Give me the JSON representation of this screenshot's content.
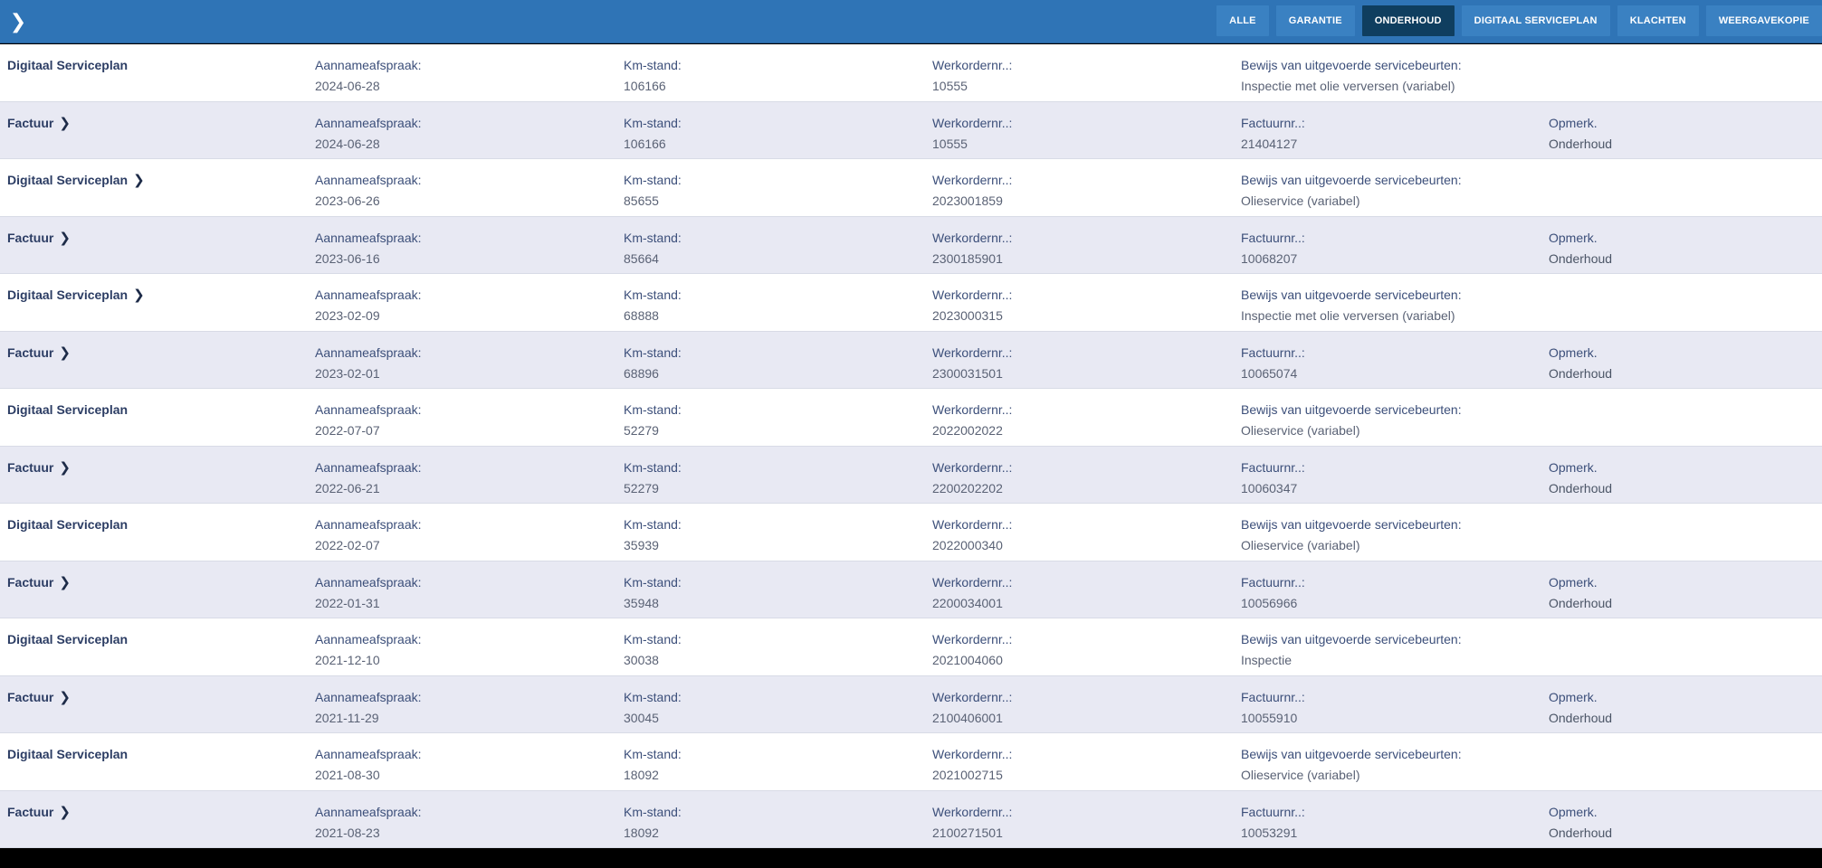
{
  "topbar": {
    "toggle_icon": "chevron-right-icon",
    "toggle_glyph": "❯",
    "tabs": [
      {
        "label": "ALLE"
      },
      {
        "label": "GARANTIE"
      },
      {
        "label": "ONDERHOUD"
      },
      {
        "label": "DIGITAAL SERVICEPLAN"
      },
      {
        "label": "KLACHTEN"
      },
      {
        "label": "WEERGAVEKOPIE"
      }
    ],
    "active_tab": "ONDERHOUD",
    "colors": {
      "bar": "#2f74b6",
      "active_tab": "#0f3e5f"
    }
  },
  "labels": {
    "appointment": "Aannameafspraak:",
    "mileage": "Km-stand:",
    "workorder": "Werkordernr..:",
    "proof": "Bewijs van uitgevoerde servicebeurten:",
    "invoice_nr": "Factuurnr..:",
    "remark": "Opmerk."
  },
  "rows": [
    {
      "type": "Digitaal Serviceplan",
      "chevron": "",
      "date": "2024-06-28",
      "km": "106166",
      "workorder": "10555",
      "kind": "plan",
      "detail": "Inspectie met olie verversen (variabel)",
      "remark": ""
    },
    {
      "type": "Factuur",
      "chevron": "❯",
      "date": "2024-06-28",
      "km": "106166",
      "workorder": "10555",
      "kind": "invoice",
      "detail": "21404127",
      "remark": "Onderhoud"
    },
    {
      "type": "Digitaal Serviceplan",
      "chevron": "❯",
      "date": "2023-06-26",
      "km": "85655",
      "workorder": "2023001859",
      "kind": "plan",
      "detail": "Olieservice (variabel)",
      "remark": ""
    },
    {
      "type": "Factuur",
      "chevron": "❯",
      "date": "2023-06-16",
      "km": "85664",
      "workorder": "2300185901",
      "kind": "invoice",
      "detail": "10068207",
      "remark": "Onderhoud"
    },
    {
      "type": "Digitaal Serviceplan",
      "chevron": "❯",
      "date": "2023-02-09",
      "km": "68888",
      "workorder": "2023000315",
      "kind": "plan",
      "detail": "Inspectie met olie verversen (variabel)",
      "remark": ""
    },
    {
      "type": "Factuur",
      "chevron": "❯",
      "date": "2023-02-01",
      "km": "68896",
      "workorder": "2300031501",
      "kind": "invoice",
      "detail": "10065074",
      "remark": "Onderhoud"
    },
    {
      "type": "Digitaal Serviceplan",
      "chevron": "",
      "date": "2022-07-07",
      "km": "52279",
      "workorder": "2022002022",
      "kind": "plan",
      "detail": "Olieservice (variabel)",
      "remark": ""
    },
    {
      "type": "Factuur",
      "chevron": "❯",
      "date": "2022-06-21",
      "km": "52279",
      "workorder": "2200202202",
      "kind": "invoice",
      "detail": "10060347",
      "remark": "Onderhoud"
    },
    {
      "type": "Digitaal Serviceplan",
      "chevron": "",
      "date": "2022-02-07",
      "km": "35939",
      "workorder": "2022000340",
      "kind": "plan",
      "detail": "Olieservice (variabel)",
      "remark": ""
    },
    {
      "type": "Factuur",
      "chevron": "❯",
      "date": "2022-01-31",
      "km": "35948",
      "workorder": "2200034001",
      "kind": "invoice",
      "detail": "10056966",
      "remark": "Onderhoud"
    },
    {
      "type": "Digitaal Serviceplan",
      "chevron": "",
      "date": "2021-12-10",
      "km": "30038",
      "workorder": "2021004060",
      "kind": "plan",
      "detail": "Inspectie",
      "remark": ""
    },
    {
      "type": "Factuur",
      "chevron": "❯",
      "date": "2021-11-29",
      "km": "30045",
      "workorder": "2100406001",
      "kind": "invoice",
      "detail": "10055910",
      "remark": "Onderhoud"
    },
    {
      "type": "Digitaal Serviceplan",
      "chevron": "",
      "date": "2021-08-30",
      "km": "18092",
      "workorder": "2021002715",
      "kind": "plan",
      "detail": "Olieservice (variabel)",
      "remark": ""
    },
    {
      "type": "Factuur",
      "chevron": "❯",
      "date": "2021-08-23",
      "km": "18092",
      "workorder": "2100271501",
      "kind": "invoice",
      "detail": "10053291",
      "remark": "Onderhoud"
    }
  ]
}
